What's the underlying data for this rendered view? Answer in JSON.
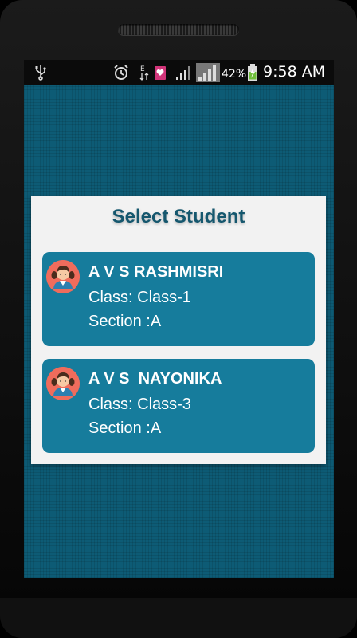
{
  "status_bar": {
    "battery_percent": "42%",
    "time": "9:58 AM",
    "icons": [
      "usb-icon",
      "alarm-icon",
      "data-transfer-icon",
      "message-icon",
      "signal-icon",
      "signal-icon",
      "battery-charging-icon"
    ]
  },
  "dialog": {
    "title": "Select Student",
    "students": [
      {
        "name": "A V S RASHMISRI",
        "class_line": "Class: Class-1",
        "section_line": "Section :A",
        "icon": "student-girl-avatar-icon"
      },
      {
        "name": "A V S  NAYONIKA",
        "class_line": "Class: Class-3",
        "section_line": "Section :A",
        "icon": "student-girl-avatar-icon"
      }
    ]
  },
  "colors": {
    "background": "#0d5b75",
    "card": "#167c9c",
    "title": "#15576e",
    "avatar": "#ef6c5c"
  }
}
